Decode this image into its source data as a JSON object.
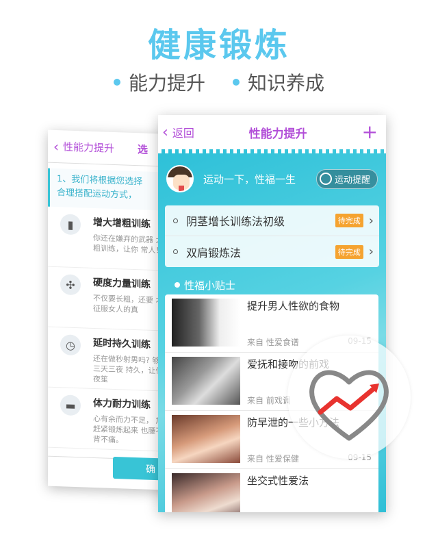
{
  "hero": {
    "title": "健康锻炼",
    "features": [
      "能力提升",
      "知识养成"
    ]
  },
  "back_screen": {
    "header_back_label": "性能力提升",
    "header_right_label": "选",
    "info_text_line1": "1、我们将根据您选择",
    "info_text_line2": "合理搭配运动方式，",
    "items": [
      {
        "icon": "bottle-icon",
        "title": "增大增粗训练",
        "desc": "你还在嫌弃的武器 大增粗训练，让你 常人！"
      },
      {
        "icon": "grip-icon",
        "title": "硬度力量训练",
        "desc": "不仅要长粗，还要 才是征服女人的真"
      },
      {
        "icon": "stopwatch-icon",
        "title": "延时持久训练",
        "desc": "还在做秒射男吗? 够大战三天三夜 持久，让你夜夜笙"
      },
      {
        "icon": "dumbbell-icon",
        "title": "体力耐力训练",
        "desc": "心有余而力不足， 尬。赶紧锻炼起来 也腰不酸背不痛。"
      }
    ],
    "confirm_label": "确"
  },
  "front_screen": {
    "back_label": "返回",
    "title": "性能力提升",
    "plus_label": "+",
    "motto": "运动一下，性福一生",
    "remind_label": "运动提醒",
    "plans": [
      {
        "name": "阴茎增长训练法初级",
        "status": "待完成"
      },
      {
        "name": "双肩锻炼法",
        "status": "待完成"
      }
    ],
    "tips_label": "性福小贴士",
    "articles": [
      {
        "title": "提升男人性欲的食物",
        "source": "来自 性爱食谱",
        "date": "09-15"
      },
      {
        "title": "爱抚和接吻的前戏",
        "source": "来自 前戏调",
        "date": ""
      },
      {
        "title": "防早泄的一些小方法",
        "source": "来自 性爱保健",
        "date": "09-15"
      },
      {
        "title": "坐交式性爱法",
        "source": "",
        "date": ""
      }
    ]
  },
  "colors": {
    "accent": "#5bc8ee",
    "purple": "#b24ed8",
    "teal": "#2dc0d8",
    "badge_orange": "#f5a330",
    "heart_gray": "#888888",
    "trend_red": "#e8332f"
  }
}
